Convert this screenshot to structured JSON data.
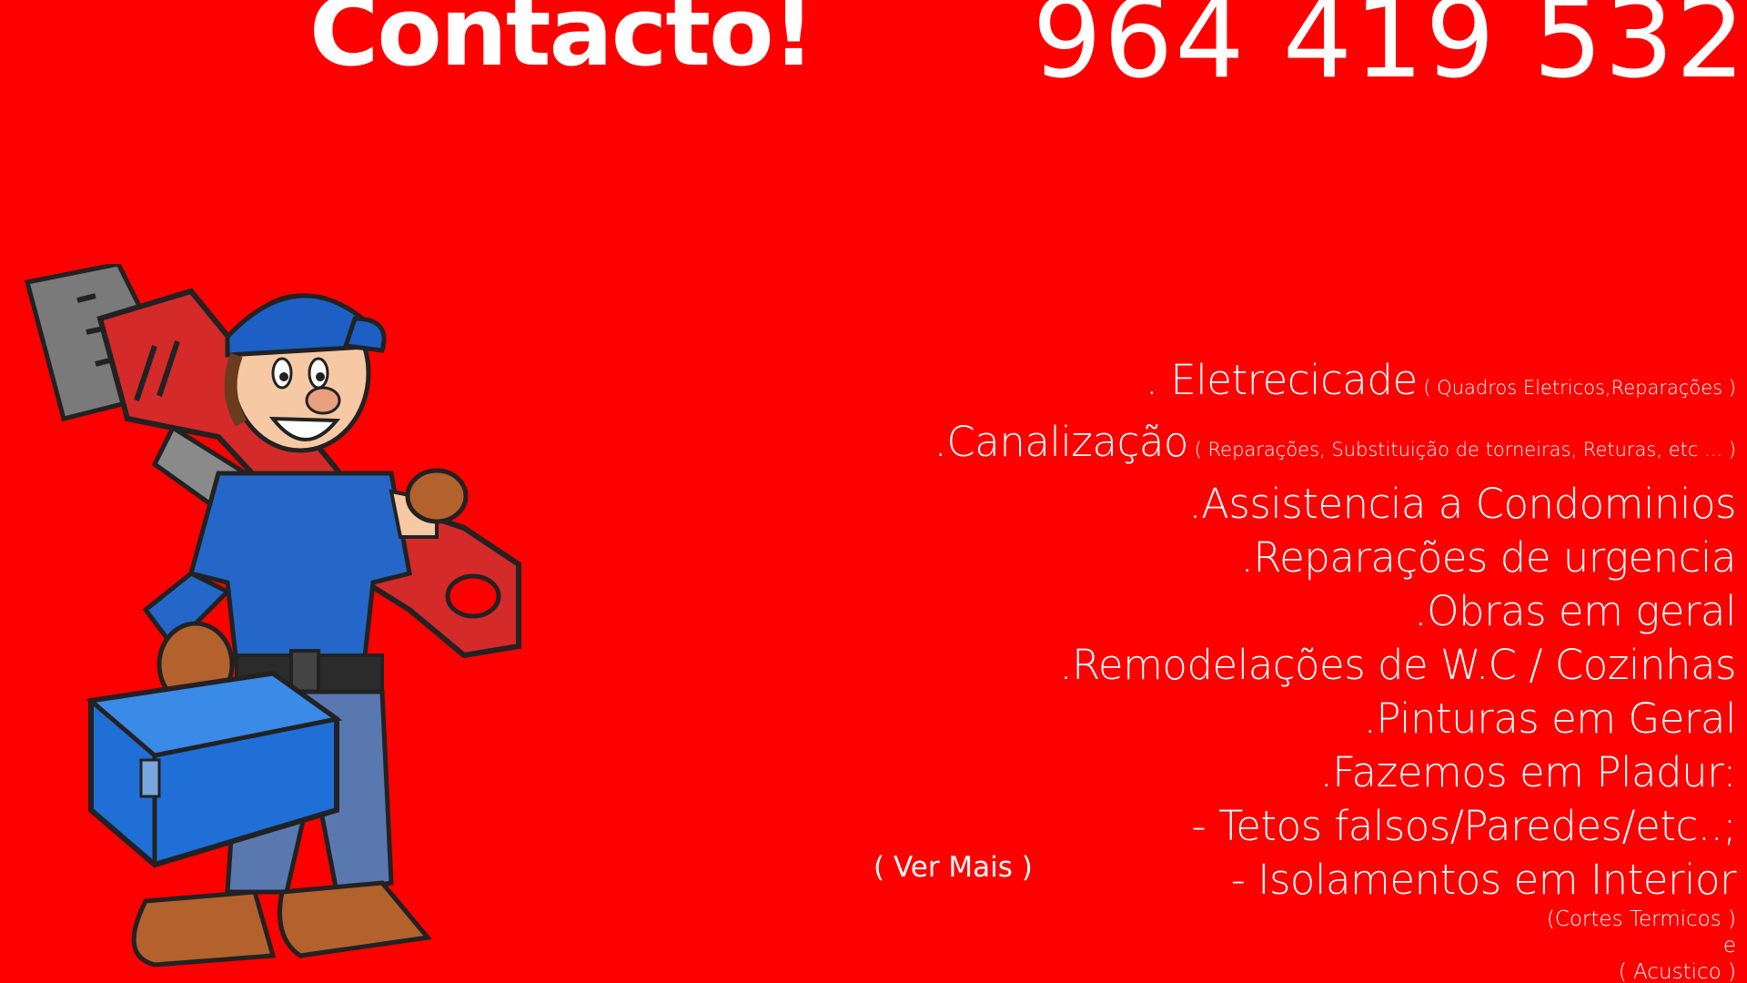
{
  "header": {
    "title": "Contacto!",
    "phone": "964 419 532"
  },
  "services": {
    "electricity": {
      "label": ". Eletrecicade",
      "note": " ( Quadros Eletricos,Reparações )"
    },
    "plumbing": {
      "label": ".Canalização",
      "note": " ( Reparações, Substituição de torneiras, Returas, etc ... )"
    },
    "condo": ".Assistencia a Condominios",
    "urgent": ".Reparações de urgencia",
    "works": ".Obras em geral",
    "remodel": ".Remodelações de W.C / Cozinhas",
    "painting": ".Pinturas em Geral",
    "drywall": ".Fazemos em Pladur:",
    "ceilings": "- Tetos falsos/Paredes/etc..;",
    "insulation": "- Isolamentos em Interior",
    "thermal": "(Cortes Termicos )",
    "and": "e",
    "acoustic": "( Acustico )"
  },
  "more_link": "( Ver Mais )",
  "colors": {
    "background": "#ff0000",
    "text": "#ffffff",
    "wrench": "#d42a2a",
    "toolbox": "#1f6fd6",
    "shirt": "#2467c8",
    "cap": "#1d5fc4"
  },
  "icons": {
    "illustration": "plumber-with-wrench-illustration"
  }
}
